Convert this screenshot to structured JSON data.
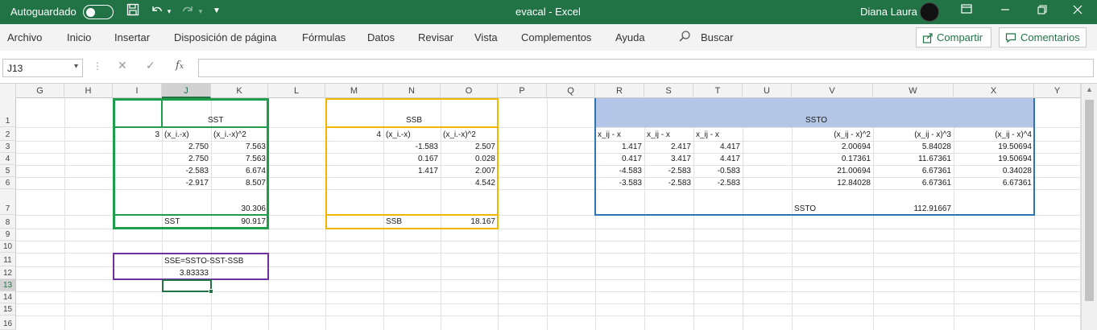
{
  "titlebar": {
    "autosave_label": "Autoguardado",
    "doc_title": "evacal  -  Excel",
    "user_name": "Diana Laura"
  },
  "ribbon": {
    "tabs": [
      "Archivo",
      "Inicio",
      "Insertar",
      "Disposición de página",
      "Fórmulas",
      "Datos",
      "Revisar",
      "Vista",
      "Complementos",
      "Ayuda"
    ],
    "search_label": "Buscar",
    "share_label": "Compartir",
    "comments_label": "Comentarios"
  },
  "formula_bar": {
    "name_box": "J13",
    "formula": ""
  },
  "columns": [
    "G",
    "H",
    "I",
    "J",
    "K",
    "L",
    "M",
    "N",
    "O",
    "P",
    "Q",
    "R",
    "S",
    "T",
    "U",
    "V",
    "W",
    "X",
    "Y"
  ],
  "rows": [
    "1",
    "2",
    "3",
    "4",
    "5",
    "6",
    "7",
    "8",
    "9",
    "10",
    "11",
    "12",
    "13",
    "14",
    "15",
    "16"
  ],
  "selected_cell": "J13",
  "sst_block": {
    "title": "SST",
    "n": "3",
    "hdr1": "(x_i.-x)",
    "hdr2": "(x_i.-x)^2",
    "col_j": [
      "2.750",
      "2.750",
      "-2.583",
      "-2.917"
    ],
    "col_k": [
      "7.563",
      "7.563",
      "6.674",
      "8.507"
    ],
    "sum": "30.306",
    "label": "SST",
    "total": "90.917"
  },
  "ssb_block": {
    "title": "SSB",
    "n": "4",
    "hdr1": "(x_i.-x)",
    "hdr2": "(x_i.-x)^2",
    "col_n": [
      "-1.583",
      "0.167",
      "1.417",
      ""
    ],
    "col_o": [
      "2.507",
      "0.028",
      "2.007",
      "4.542"
    ],
    "label": "SSB",
    "total": "18.167"
  },
  "ssto_block": {
    "title": "SSTO",
    "headers": [
      "x_ij - x",
      "x_ij - x",
      "x_ij - x",
      "(x_ij - x)^2",
      "(x_ij - x)^3",
      "(x_ij - x)^4"
    ],
    "col_r": [
      "1.417",
      "0.417",
      "-4.583",
      "-3.583"
    ],
    "col_s": [
      "2.417",
      "3.417",
      "-2.583",
      "-2.583"
    ],
    "col_t": [
      "4.417",
      "4.417",
      "-0.583",
      "-2.583"
    ],
    "col_v": [
      "2.00694",
      "0.17361",
      "21.00694",
      "12.84028"
    ],
    "col_w": [
      "5.84028",
      "11.67361",
      "6.67361",
      "6.67361"
    ],
    "col_x": [
      "19.50694",
      "19.50694",
      "0.34028",
      "6.67361"
    ],
    "label": "SSTO",
    "total": "112.91667"
  },
  "sse_block": {
    "formula": "SSE=SSTO-SST-SSB",
    "value": "3.83333"
  },
  "colors": {
    "excel_green": "#217346",
    "sst_border": "#1e9e4a",
    "ssb_border": "#f2b600",
    "ssto_border": "#2e74b5",
    "ssto_fill": "#b4c6e7",
    "sse_border": "#7030a0"
  },
  "icons": [
    "save-icon",
    "undo-icon",
    "redo-icon",
    "customize-qat-icon",
    "avatar",
    "ribbon-display-icon",
    "minimize-icon",
    "restore-icon",
    "close-icon",
    "search-icon",
    "share-icon",
    "comment-icon",
    "cancel-icon",
    "enter-icon",
    "fx-icon"
  ]
}
